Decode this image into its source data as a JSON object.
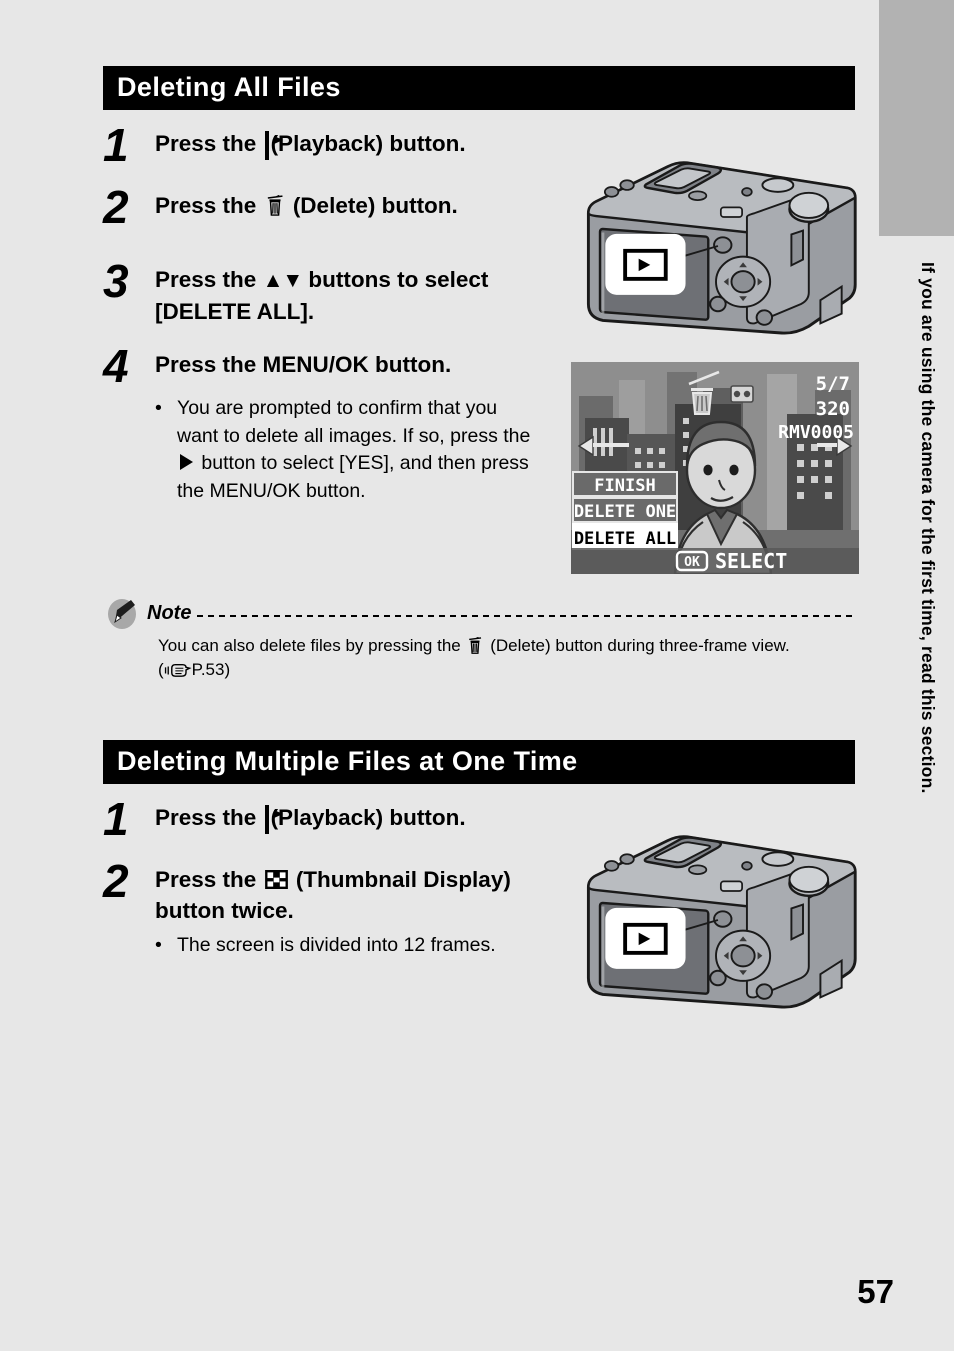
{
  "page": {
    "number": "57",
    "side_tab_text": "If you are using the camera for the first time, read this section."
  },
  "sections": [
    {
      "header": "Deleting All Files",
      "steps": [
        {
          "num": "1",
          "pre": "Press the ",
          "icon": "playback-icon",
          "post": " (Playback) button."
        },
        {
          "num": "2",
          "pre": "Press the ",
          "icon": "delete-trash-icon",
          "post": " (Delete) button."
        },
        {
          "num": "3",
          "pre": "Press the ",
          "icon": "up-down-arrows-icon",
          "post": " buttons to select [DELETE ALL]."
        },
        {
          "num": "4",
          "pre": "Press the MENU/OK button.",
          "icon": "",
          "post": ""
        }
      ],
      "bullet": {
        "part1": "You are prompted to confirm that you want to delete all images. If so, press the ",
        "icon": "right-arrow-icon",
        "part2": " button to select [YES], and then press the MENU/OK button."
      },
      "note": {
        "label": "Note",
        "body_part1": "You can also delete files by pressing the ",
        "body_icon": "delete-trash-icon",
        "body_part2": " (Delete) button during three-frame view.",
        "ref_open": "(",
        "ref_icon": "pointing-hand-icon",
        "ref_page": "P.53",
        "ref_close": ")"
      }
    },
    {
      "header": "Deleting Multiple Files at One Time",
      "steps": [
        {
          "num": "1",
          "pre": "Press the ",
          "icon": "playback-icon",
          "post": " (Playback) button."
        },
        {
          "num": "2",
          "pre": "Press the ",
          "icon": "thumbnail-display-icon",
          "post": " (Thumbnail Display) button twice."
        }
      ],
      "bullet": {
        "part1": "The screen is divided into 12 frames.",
        "icon": "",
        "part2": ""
      }
    }
  ],
  "camera_figure": {
    "callout_icon": "playback-icon",
    "alt": "camera-rear-view-with-playback-button-callout"
  },
  "lcd_screen": {
    "menu_items": [
      {
        "label": "FINISH",
        "selected": false
      },
      {
        "label": "DELETE ONE",
        "selected": false
      },
      {
        "label": "DELETE ALL",
        "selected": true
      }
    ],
    "frame_counter": "5/7",
    "resolution": "320",
    "file_name": "RMV0005",
    "footer_button": "OK",
    "footer_label": "SELECT"
  },
  "colors": {
    "page_background": "#e7e7e7",
    "header_bar": "#000000",
    "edge_tab": "#b2b2b2",
    "camera_body": "#9a9da2"
  }
}
